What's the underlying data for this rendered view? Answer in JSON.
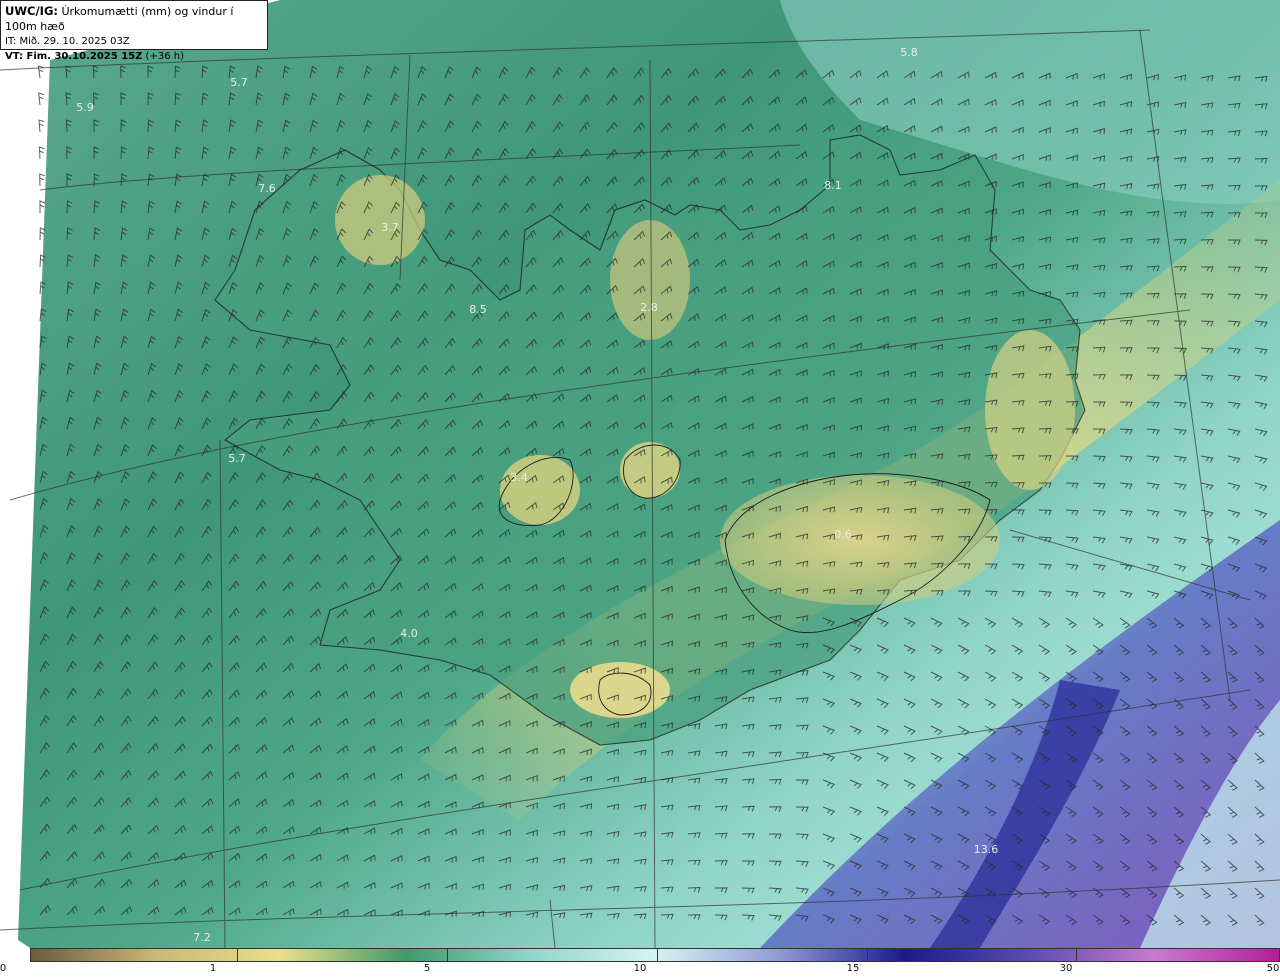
{
  "header": {
    "title_bold": "UWC/IG:",
    "title_rest": " Úrkomumætti (mm) og vindur í 100m hæð",
    "initial_time": "IT: Mið. 29. 10. 2025 03Z",
    "valid_bold": "VT: Fim. 30.10.2025 15Z",
    "valid_rest": " (+36 h)"
  },
  "map_labels": [
    "5.7",
    "5.9",
    "5.8",
    "8.1",
    "7.6",
    "3.7",
    "8.5",
    "2.8",
    "5.7",
    "3.4",
    "0.6",
    "4.0",
    "13.6",
    "7.2"
  ],
  "colorbar": {
    "ticks": [
      "0",
      "1",
      "5",
      "10",
      "15",
      "30",
      "50"
    ],
    "colors": [
      "#6b5a3e",
      "#c9b877",
      "#e8e08a",
      "#3f9a6a",
      "#8fd6cc",
      "#d6f4f0",
      "#8f9ad6",
      "#1a1a8a",
      "#5b4bb0",
      "#c87ad0",
      "#b0209a"
    ]
  },
  "colors": {
    "sea_green": "#4aa891",
    "land_yellow": "#d9d27f",
    "deep_blue": "#26319a",
    "coastline": "#1a1a1a"
  }
}
